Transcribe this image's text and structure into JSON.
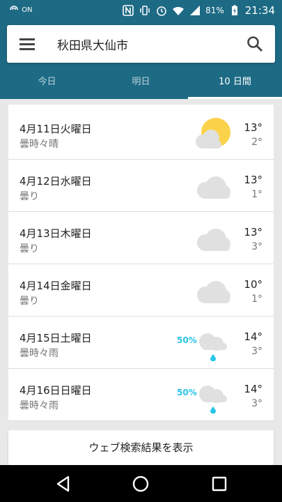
{
  "status_bar": {
    "battery_pct": "81%",
    "time": "21:34",
    "left_tag": "ON"
  },
  "search": {
    "query": "秋田県大仙市"
  },
  "tabs": [
    {
      "label": "今日",
      "active": false
    },
    {
      "label": "明日",
      "active": false
    },
    {
      "label": "10 日間",
      "active": true
    }
  ],
  "forecast": [
    {
      "date": "4月11日火曜日",
      "condition": "曇時々晴",
      "icon": "partly-sunny-icon",
      "precip": "",
      "high": "13°",
      "low": "2°"
    },
    {
      "date": "4月12日水曜日",
      "condition": "曇り",
      "icon": "cloud-icon",
      "precip": "",
      "high": "13°",
      "low": "1°"
    },
    {
      "date": "4月13日木曜日",
      "condition": "曇り",
      "icon": "cloud-icon",
      "precip": "",
      "high": "13°",
      "low": "3°"
    },
    {
      "date": "4月14日金曜日",
      "condition": "曇り",
      "icon": "cloud-icon",
      "precip": "",
      "high": "10°",
      "low": "1°"
    },
    {
      "date": "4月15日土曜日",
      "condition": "曇時々雨",
      "icon": "rain-cloud-icon",
      "precip": "50%",
      "high": "14°",
      "low": "3°"
    },
    {
      "date": "4月16日日曜日",
      "condition": "曇時々雨",
      "icon": "rain-cloud-icon",
      "precip": "50%",
      "high": "14°",
      "low": "3°"
    }
  ],
  "web_results_label": "ウェブ検索結果を表示",
  "colors": {
    "header": "#1d6a84",
    "precip": "#29c5e6",
    "sun": "#fbd34a",
    "cloud": "#e0e0e0"
  }
}
